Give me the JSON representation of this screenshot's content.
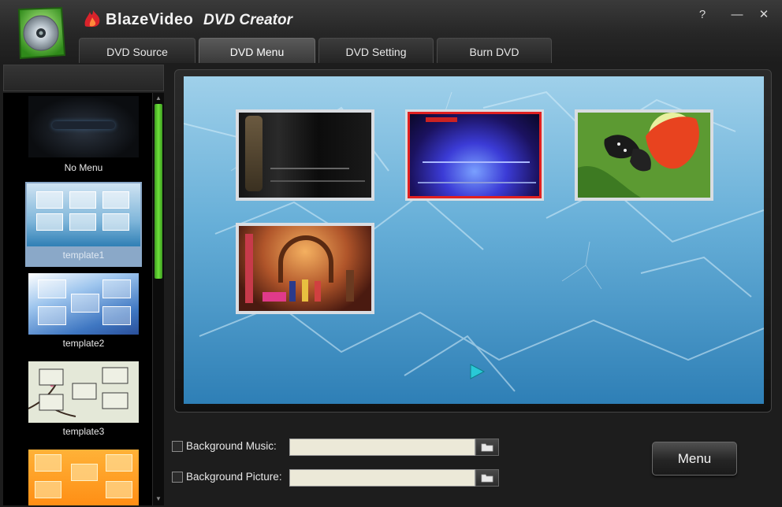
{
  "app": {
    "brand": "BlazeVideo",
    "product": "DVD Creator"
  },
  "window_controls": {
    "help": "?",
    "minimize": "—",
    "close": "✕"
  },
  "tabs": [
    {
      "label": "DVD Source",
      "active": false
    },
    {
      "label": "DVD Menu",
      "active": true
    },
    {
      "label": "DVD Setting",
      "active": false
    },
    {
      "label": "Burn DVD",
      "active": false
    }
  ],
  "templates": [
    {
      "label": "No Menu",
      "selected": false
    },
    {
      "label": "template1",
      "selected": true
    },
    {
      "label": "template2",
      "selected": false
    },
    {
      "label": "template3",
      "selected": false
    },
    {
      "label": "",
      "selected": false
    }
  ],
  "preview": {
    "thumbnails": [
      {
        "name": "dark-scene",
        "selected": false
      },
      {
        "name": "concert-stage",
        "selected": true
      },
      {
        "name": "butterfly-flower",
        "selected": false
      },
      {
        "name": "stage-performers",
        "selected": false
      }
    ],
    "play_icon": "play-icon"
  },
  "options": {
    "background_music": {
      "label": "Background Music:",
      "checked": false,
      "value": ""
    },
    "background_picture": {
      "label": "Background Picture:",
      "checked": false,
      "value": ""
    }
  },
  "menu_button": {
    "label": "Menu"
  },
  "colors": {
    "accent_green": "#5cc82e",
    "selected_border": "#e02020",
    "frost_blue": "#6fb6dc"
  }
}
